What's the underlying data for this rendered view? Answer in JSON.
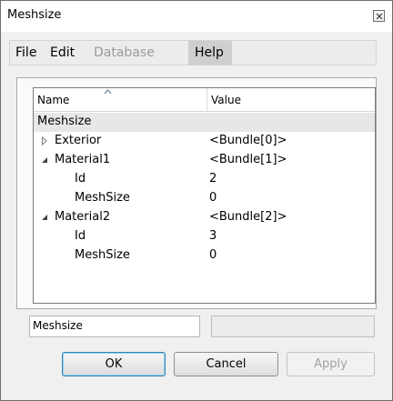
{
  "window": {
    "title": "Meshsize"
  },
  "menu": {
    "file": "File",
    "edit": "Edit",
    "database": "Database",
    "help": "Help"
  },
  "tree": {
    "header": {
      "name": "Name",
      "value": "Value"
    },
    "group": "Meshsize",
    "rows": [
      {
        "name": "Exterior",
        "value": "<Bundle[0]>"
      },
      {
        "name": "Material1",
        "value": "<Bundle[1]>"
      },
      {
        "name": "Id",
        "value": "2"
      },
      {
        "name": "MeshSize",
        "value": "0"
      },
      {
        "name": "Material2",
        "value": "<Bundle[2]>"
      },
      {
        "name": "Id",
        "value": "3"
      },
      {
        "name": "MeshSize",
        "value": "0"
      }
    ]
  },
  "bottom": {
    "name_field": "Meshsize"
  },
  "buttons": {
    "ok": "OK",
    "cancel": "Cancel",
    "apply": "Apply"
  }
}
